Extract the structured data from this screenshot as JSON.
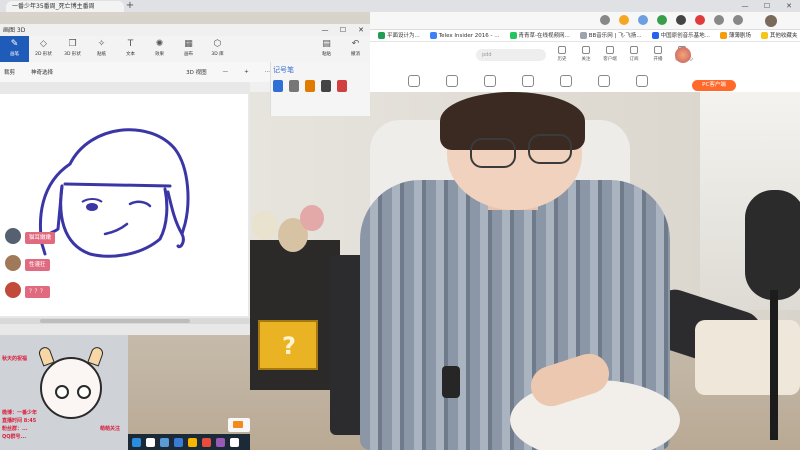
{
  "browser": {
    "tabs": [
      {
        "label": "一番少年35番周_死亡博主番周"
      },
      {
        "label": ""
      }
    ],
    "new_tab": "+",
    "window_controls": [
      "—",
      "☐",
      "✕"
    ],
    "bookmarks": [
      {
        "label": "平面设计为...",
        "color": "#1f9d55"
      },
      {
        "label": "Telex Insider 2016 - ...",
        "color": "#3b82f6"
      },
      {
        "label": "青青草-在线视频网...",
        "color": "#22c55e"
      },
      {
        "label": "BB音乐网 | 飞·飞扬...",
        "color": "#9ca3af"
      },
      {
        "label": "中国原创音乐基地...",
        "color": "#2563eb"
      },
      {
        "label": "薄薄剧场",
        "color": "#f59e0b"
      },
      {
        "label": "其他收藏夹",
        "color": "#f5c518"
      }
    ],
    "site": {
      "search_placeholder": "pdd",
      "nav": [
        {
          "label": "历史"
        },
        {
          "label": "关注"
        },
        {
          "label": "客户端"
        },
        {
          "label": "订阅"
        },
        {
          "label": "开播"
        },
        {
          "label": "任务中心"
        }
      ],
      "pc_client_button": "PC客户端"
    }
  },
  "paint": {
    "title": "画图 3D",
    "window_controls": [
      "—",
      "☐",
      "✕"
    ],
    "ribbon": [
      {
        "label": "画笔",
        "icon": "✎",
        "active": true
      },
      {
        "label": "2D 形状",
        "icon": "◇",
        "active": false
      },
      {
        "label": "3D 形状",
        "icon": "❒",
        "active": false
      },
      {
        "label": "贴纸",
        "icon": "✧",
        "active": false
      },
      {
        "label": "文本",
        "icon": "T",
        "active": false
      },
      {
        "label": "效果",
        "icon": "✺",
        "active": false
      },
      {
        "label": "画布",
        "icon": "▦",
        "active": false
      },
      {
        "label": "3D 库",
        "icon": "⬡",
        "active": false
      }
    ],
    "ribbon_right": [
      {
        "label": "粘贴",
        "icon": "▤"
      },
      {
        "label": "撤消",
        "icon": "↶"
      }
    ],
    "sub_toolbar": {
      "crop": "裁剪",
      "magic_select": "神奇选择",
      "view_3d": "3D 视图",
      "minus": "—",
      "plus": "+",
      "more": "···"
    },
    "brush_panel_title": "记号笔",
    "brush_colors": [
      "#2f6fd6",
      "#777777",
      "#e07b00",
      "#444444",
      "#d04040"
    ]
  },
  "drawing": {
    "stroke_color": "#3b36a6"
  },
  "chat": [
    {
      "text": "猫耳嫩嫩",
      "avatar_color": "#556070"
    },
    {
      "text": "性灌狂",
      "avatar_color": "#a07a58"
    },
    {
      "text": "？？？",
      "avatar_color": "#c24a3a"
    }
  ],
  "overlay": {
    "side_left": "秋天的祝福",
    "side_right": "萌萌关注",
    "lines": [
      "微博：一番少年",
      "直播时间 8:45",
      "粉丝群：...",
      "QQ群号..."
    ]
  },
  "taskbar": {
    "icons": [
      "#2a8de0",
      "#ffffff",
      "#5a9ad6",
      "#3a7bd5",
      "#f7b500",
      "#e74c3c",
      "#9b59b6",
      "#ffffff"
    ]
  },
  "notification": {
    "icon": "mail-icon"
  },
  "scene": {
    "block_mark": "?"
  }
}
